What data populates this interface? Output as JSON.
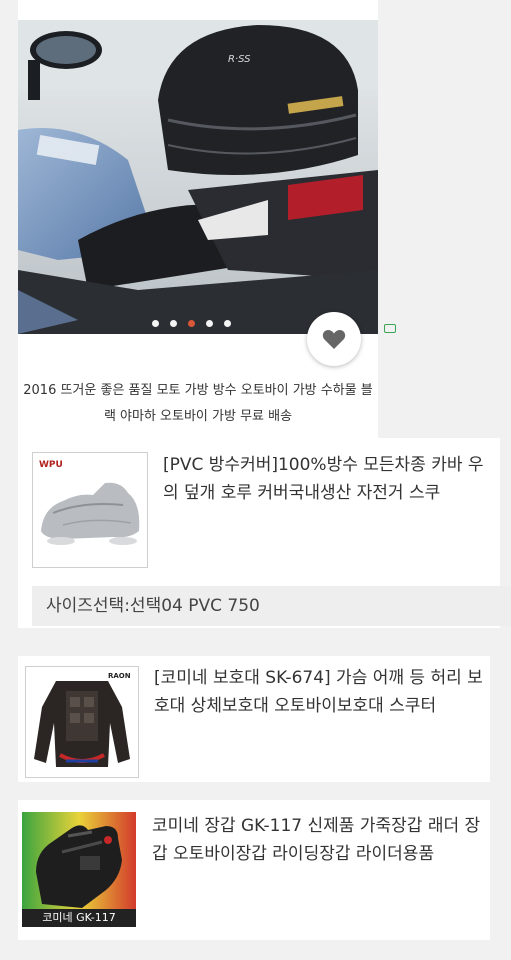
{
  "featured": {
    "title": "2016 뜨거운 좋은 품질 모토 가방 방수 오토바이 가방 수하물 블랙 야마하 오토바이 가방 무료 배송",
    "image_icon": "motorcycle-tail-bag-photo",
    "carousel_active_index": 2,
    "carousel_count": 5,
    "favorite_icon": "heart-icon"
  },
  "products": [
    {
      "name": "[PVC 방수커버]100%방수 모든차종 카바 우의 덮개 호루 커버국내생산 자전거 스쿠",
      "image_icon": "motorcycle-cover-photo",
      "brand_mark": "WPU",
      "option": "사이즈선택:선택04 PVC 750"
    },
    {
      "name": "[코미네 보호대 SK-674] 가슴 어깨 등 허리 보호대 상체보호대 오토바이보호대 스쿠터",
      "image_icon": "body-armor-jacket-photo",
      "brand_mark": "RAON"
    },
    {
      "name": "코미네 장갑 GK-117 신제품 가죽장갑 래더 장갑 오토바이장갑 라이딩장갑 라이더용품",
      "image_icon": "riding-glove-photo",
      "image_caption": "코미네 GK-117"
    }
  ],
  "colors": {
    "background": "#f1f1f1",
    "card": "#ffffff",
    "accent_dot": "#e45b3b",
    "heart": "#666666"
  }
}
